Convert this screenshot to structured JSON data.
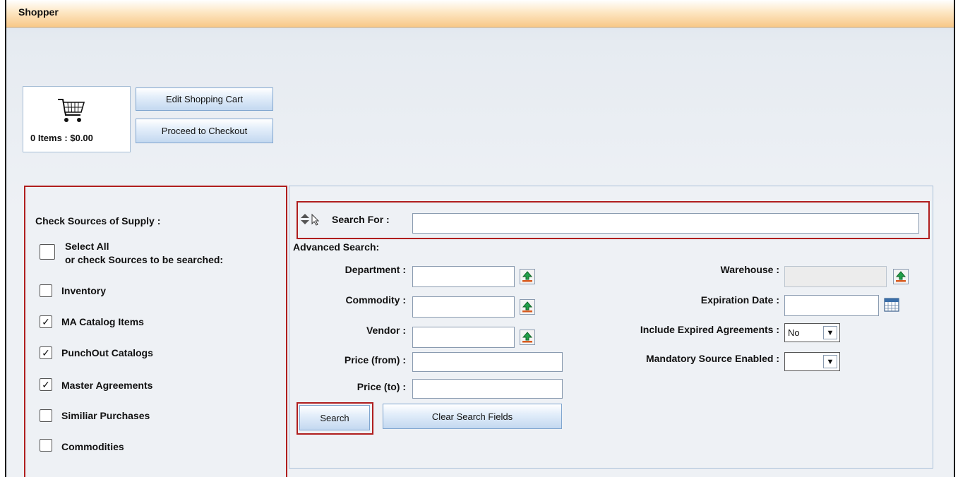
{
  "header": {
    "title": "Shopper"
  },
  "cart": {
    "icon": "shopping-cart-icon",
    "summary": "0 Items : $0.00",
    "edit_label": "Edit Shopping Cart",
    "checkout_label": "Proceed to Checkout"
  },
  "sources": {
    "title": "Check Sources of Supply :",
    "select_all_line1": "Select All",
    "select_all_line2": "or check Sources to be searched:",
    "select_all_checked": false,
    "items": [
      {
        "label": "Inventory",
        "checked": false
      },
      {
        "label": "MA Catalog Items",
        "checked": true
      },
      {
        "label": "PunchOut Catalogs",
        "checked": true
      },
      {
        "label": "Master Agreements",
        "checked": true
      },
      {
        "label": "Similiar Purchases",
        "checked": false
      },
      {
        "label": "Commodities",
        "checked": false
      }
    ]
  },
  "search": {
    "search_for_label": "Search For :",
    "search_for_value": "",
    "advanced_label": "Advanced Search:",
    "department_label": "Department :",
    "commodity_label": "Commodity :",
    "vendor_label": "Vendor :",
    "price_from_label": "Price (from) :",
    "price_to_label": "Price (to) :",
    "warehouse_label": "Warehouse :",
    "expiration_label": "Expiration Date :",
    "include_expired_label": "Include Expired Agreements :",
    "include_expired_value": "No",
    "mandatory_label": "Mandatory Source Enabled :",
    "mandatory_value": "",
    "search_button": "Search",
    "clear_button": "Clear Search Fields"
  },
  "colors": {
    "highlight": "#b01e1e",
    "title_bar": "#f8c888",
    "button": "#c3d8f0"
  }
}
